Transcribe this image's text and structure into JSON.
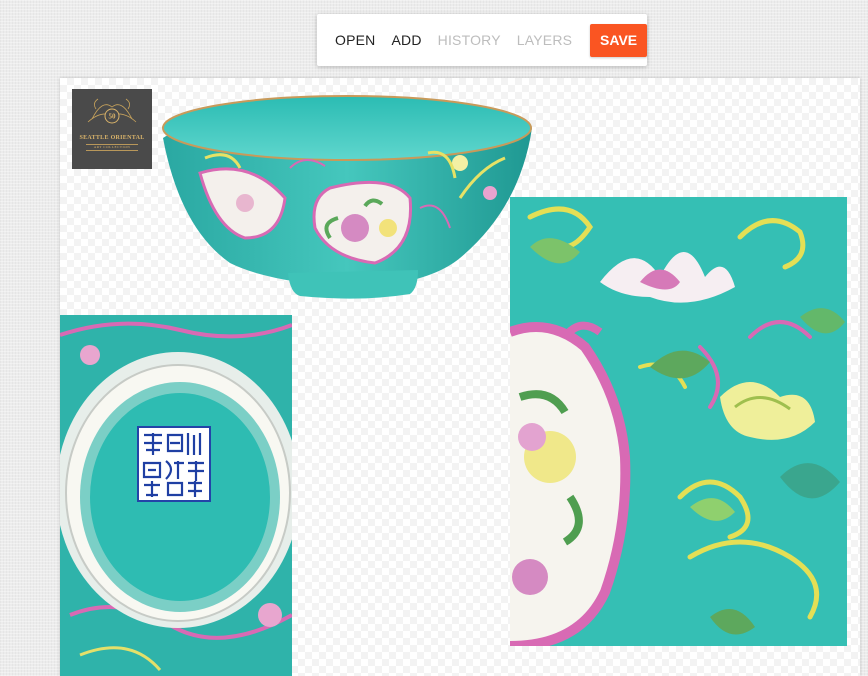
{
  "toolbar": {
    "open_label": "OPEN",
    "add_label": "ADD",
    "history_label": "HISTORY",
    "layers_label": "LAYERS",
    "save_label": "SAVE"
  },
  "logo": {
    "badge": "50",
    "name": "SEATTLE ORIENTAL",
    "sub": "ART COLLECTION"
  },
  "colors": {
    "accent": "#fa5522",
    "turquoise": "#35bfb4",
    "pink": "#d86ab4"
  }
}
